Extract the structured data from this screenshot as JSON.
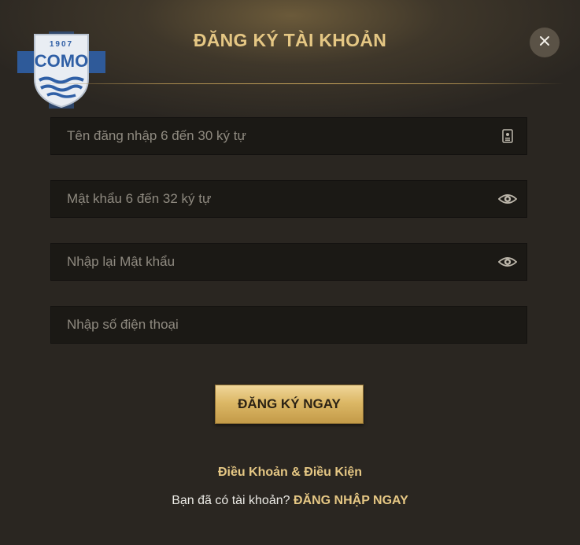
{
  "header": {
    "title": "ĐĂNG KÝ TÀI KHOẢN",
    "logo": {
      "year": "1907",
      "name": "COMO"
    },
    "close_icon": "close-icon"
  },
  "form": {
    "username": {
      "placeholder": "Tên đăng nhập 6 đến 30 ký tự",
      "value": "",
      "icon": "id-card-icon"
    },
    "password": {
      "placeholder": "Mật khẩu 6 đến 32 ký tự",
      "value": "",
      "icon": "eye-icon"
    },
    "confirm_password": {
      "placeholder": "Nhập lại Mật khẩu",
      "value": "",
      "icon": "eye-icon"
    },
    "phone": {
      "placeholder": "Nhập số điện thoại",
      "value": ""
    },
    "submit_label": "ĐĂNG KÝ NGAY"
  },
  "footer": {
    "terms_label": "Điều Khoản & Điều Kiện",
    "login_prompt": "Bạn đã có tài khoản?",
    "login_link": "ĐĂNG NHẬP NGAY"
  },
  "colors": {
    "accent_gold": "#e5c784",
    "background": "#2a2621",
    "field_bg": "#1b1915",
    "button_gold": "#dcb866"
  }
}
